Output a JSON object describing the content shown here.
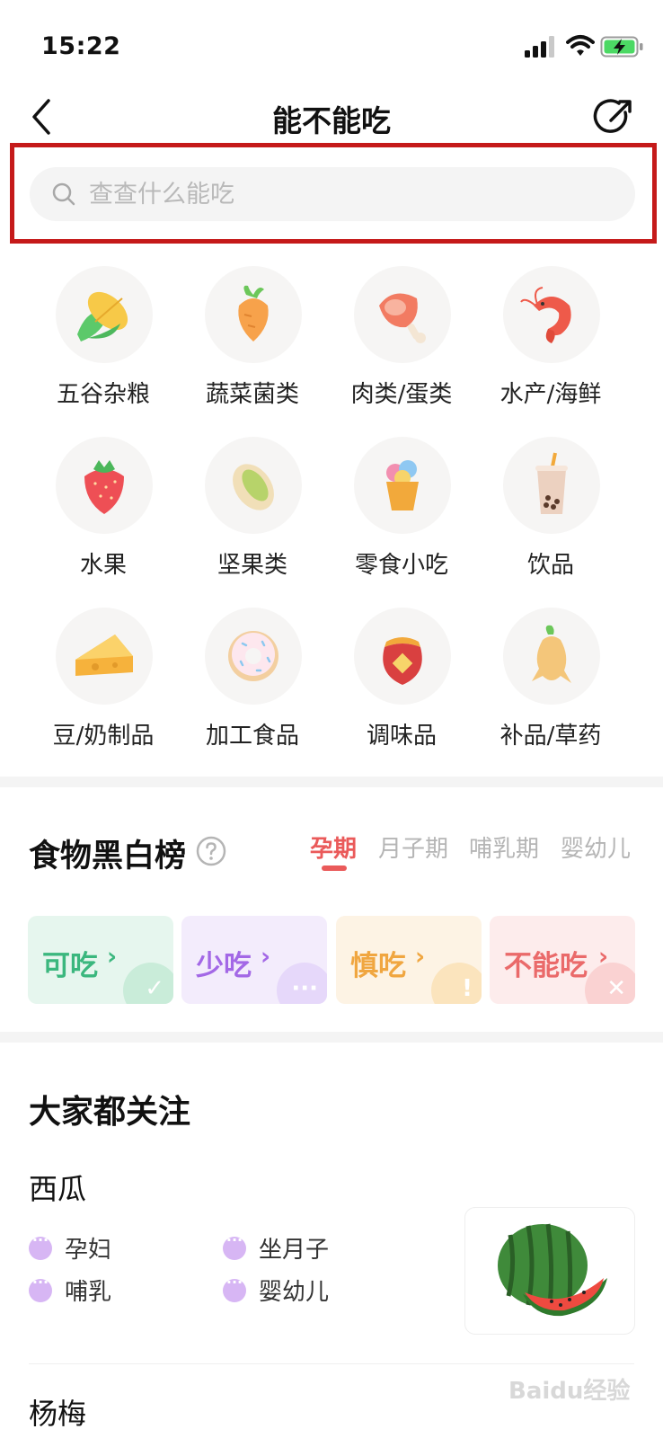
{
  "status_bar": {
    "time": "15:22"
  },
  "header": {
    "title": "能不能吃"
  },
  "search": {
    "placeholder": "查查什么能吃"
  },
  "categories": [
    {
      "label": "五谷杂粮",
      "icon": "corn-icon"
    },
    {
      "label": "蔬菜菌类",
      "icon": "carrot-icon"
    },
    {
      "label": "肉类/蛋类",
      "icon": "meat-leg-icon"
    },
    {
      "label": "水产/海鲜",
      "icon": "shrimp-icon"
    },
    {
      "label": "水果",
      "icon": "strawberry-icon"
    },
    {
      "label": "坚果类",
      "icon": "pistachio-icon"
    },
    {
      "label": "零食小吃",
      "icon": "ice-cream-icon"
    },
    {
      "label": "饮品",
      "icon": "bubble-tea-icon"
    },
    {
      "label": "豆/奶制品",
      "icon": "cheese-icon"
    },
    {
      "label": "加工食品",
      "icon": "donut-icon"
    },
    {
      "label": "调味品",
      "icon": "seasoning-jar-icon"
    },
    {
      "label": "补品/草药",
      "icon": "ginseng-icon"
    }
  ],
  "ranking": {
    "title": "食物黑白榜",
    "tabs": [
      "孕期",
      "月子期",
      "哺乳期",
      "婴幼儿"
    ],
    "active_tab": "孕期",
    "cards": [
      {
        "label": "可吃",
        "arrow": "›",
        "color": "#3bb77e",
        "bg": "#e6f6ee"
      },
      {
        "label": "少吃",
        "arrow": "›",
        "color": "#a368e6",
        "bg": "#f3ecfc"
      },
      {
        "label": "慎吃",
        "arrow": "›",
        "color": "#f0a640",
        "bg": "#fdf3e4"
      },
      {
        "label": "不能吃",
        "arrow": "›",
        "color": "#ea6a6a",
        "bg": "#fdecec"
      }
    ]
  },
  "popular": {
    "title": "大家都关注",
    "items": [
      {
        "name": "西瓜",
        "tags": [
          "孕妇",
          "坐月子",
          "哺乳",
          "婴幼儿"
        ]
      },
      {
        "name": "杨梅"
      }
    ]
  },
  "watermark": "Baidu经验"
}
